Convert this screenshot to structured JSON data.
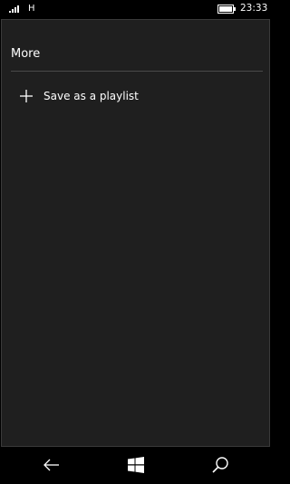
{
  "status_bar": {
    "network_type": "H",
    "time": "23:33",
    "signal_icon": "signal-bars-icon",
    "battery_icon": "battery-icon"
  },
  "panel": {
    "title": "More",
    "items": [
      {
        "icon": "plus-icon",
        "label": "Save as a playlist"
      }
    ]
  },
  "nav_bar": {
    "back_icon": "back-arrow-icon",
    "home_icon": "windows-logo-icon",
    "search_icon": "search-icon"
  },
  "colors": {
    "background": "#000000",
    "panel": "#1f1f1f",
    "text": "#ffffff"
  }
}
